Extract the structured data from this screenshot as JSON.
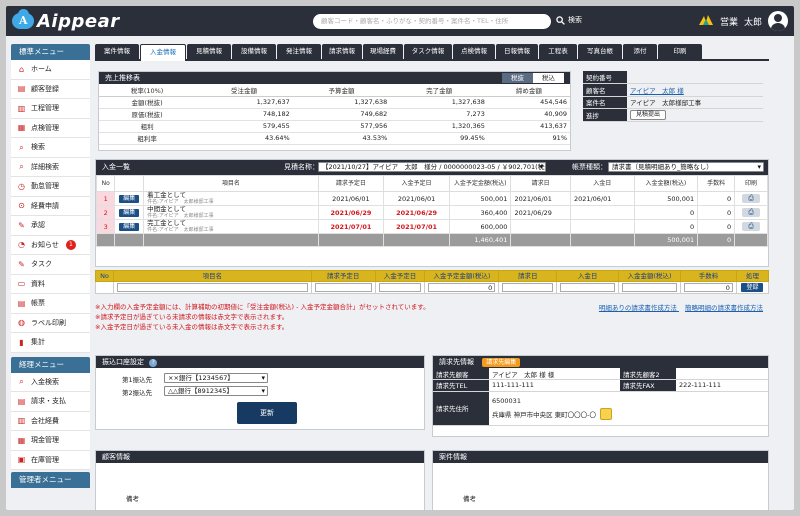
{
  "header": {
    "logo_letter": "A",
    "logo_text": "Aippear",
    "search_placeholder": "顧客コード・顧客名・ふりがな・契約番号・案件名・TEL・住所",
    "search_label": "検索",
    "user_dept": "営業",
    "user_name": "太郎"
  },
  "sidebar": {
    "standard_title": "標準メニュー",
    "standard_items": [
      {
        "label": "ホーム",
        "icon": "home-icon",
        "glyph": "⌂"
      },
      {
        "label": "顧客登録",
        "icon": "customer-icon",
        "glyph": "▤"
      },
      {
        "label": "工程管理",
        "icon": "process-icon",
        "glyph": "▥"
      },
      {
        "label": "点検管理",
        "icon": "inspection-icon",
        "glyph": "▦"
      },
      {
        "label": "検索",
        "icon": "search-icon",
        "glyph": "⌕"
      },
      {
        "label": "詳細検索",
        "icon": "detail-search-icon",
        "glyph": "⌕"
      },
      {
        "label": "勤怠管理",
        "icon": "attendance-icon",
        "glyph": "◷"
      },
      {
        "label": "経費申請",
        "icon": "expense-icon",
        "glyph": "⊙"
      },
      {
        "label": "承認",
        "icon": "approval-icon",
        "glyph": "✎"
      },
      {
        "label": "お知らせ",
        "icon": "notice-icon",
        "glyph": "◔",
        "badge": "1"
      },
      {
        "label": "タスク",
        "icon": "task-icon",
        "glyph": "✎"
      },
      {
        "label": "資料",
        "icon": "document-icon",
        "glyph": "▭"
      },
      {
        "label": "帳票",
        "icon": "form-icon",
        "glyph": "▤"
      },
      {
        "label": "ラベル印刷",
        "icon": "label-print-icon",
        "glyph": "◍"
      },
      {
        "label": "集計",
        "icon": "aggregate-icon",
        "glyph": "▮"
      }
    ],
    "accounting_title": "経理メニュー",
    "accounting_items": [
      {
        "label": "入金検索",
        "icon": "payment-search-icon",
        "glyph": "⌕"
      },
      {
        "label": "請求・支払",
        "icon": "billing-icon",
        "glyph": "▤"
      },
      {
        "label": "会社経費",
        "icon": "company-expense-icon",
        "glyph": "▥"
      },
      {
        "label": "現金管理",
        "icon": "cash-icon",
        "glyph": "▦"
      },
      {
        "label": "在庫管理",
        "icon": "inventory-icon",
        "glyph": "▣"
      }
    ],
    "admin_title": "管理者メニュー"
  },
  "tabs": [
    "案件情報",
    "入金情報",
    "見積情報",
    "設備情報",
    "発注情報",
    "請求情報",
    "現場経費",
    "タスク情報",
    "点検情報",
    "日報情報",
    "工程表",
    "写真台帳",
    "添付",
    "印刷"
  ],
  "active_tab": 1,
  "sales": {
    "title": "売上推移表",
    "toggle": [
      "税抜",
      "税込"
    ],
    "headers": [
      "税率(10%)",
      "受注金額",
      "予算金額",
      "完了金額",
      "締め金額"
    ],
    "rows": [
      [
        "金額(税抜)",
        "1,327,637",
        "1,327,638",
        "1,327,638",
        "454,546"
      ],
      [
        "原価(税抜)",
        "748,182",
        "749,682",
        "7,273",
        "40,909"
      ],
      [
        "粗利",
        "579,455",
        "577,956",
        "1,320,365",
        "413,637"
      ],
      [
        "粗利率",
        "43.64%",
        "43.53%",
        "99.45%",
        "91%"
      ]
    ]
  },
  "contract": {
    "rows": [
      {
        "k": "契約番号",
        "v": ""
      },
      {
        "k": "顧客名",
        "v": "アイピア　太郎 様"
      },
      {
        "k": "案件名",
        "v": "アイピア　太郎様邸工事"
      },
      {
        "k": "進捗",
        "v": "見積提出"
      }
    ]
  },
  "payments": {
    "title": "入金一覧",
    "estimate_label": "見積名称：",
    "estimate_value": "【2021/10/27】アイピア　太郎　様分 / 0000000023-05 / ￥902,701(税込)",
    "form_label": "帳票種類：",
    "form_value": "請求書（見積明細あり_簡略なし）",
    "headers": [
      "No",
      "",
      "項目名",
      "請求予定日",
      "入金予定日",
      "入金予定金額(税込)",
      "請求日",
      "入金日",
      "入金金額(税込)",
      "手数料",
      "印刷"
    ],
    "edit_label": "編集",
    "print_glyph": "⎙",
    "rows": [
      {
        "no": "1",
        "name": "着工金として",
        "sub": "件名:アイピア　太郎様邸工事",
        "bill_plan": "2021/06/01",
        "pay_plan": "2021/06/01",
        "plan_amt": "500,001",
        "bill_date": "2021/06/01",
        "pay_date": "2021/06/01",
        "pay_amt": "500,001",
        "fee": "0",
        "red": false
      },
      {
        "no": "2",
        "name": "中間金として",
        "sub": "件名:アイピア　太郎様邸工事",
        "bill_plan": "2021/06/29",
        "pay_plan": "2021/06/29",
        "plan_amt": "360,400",
        "bill_date": "2021/06/29",
        "pay_date": "",
        "pay_amt": "0",
        "fee": "0",
        "red": true
      },
      {
        "no": "3",
        "name": "完工金として",
        "sub": "件名:アイピア　太郎様邸工事",
        "bill_plan": "2021/07/01",
        "pay_plan": "2021/07/01",
        "plan_amt": "600,000",
        "bill_date": "",
        "pay_date": "",
        "pay_amt": "0",
        "fee": "0",
        "red": true
      }
    ],
    "total_plan": "1,460,401",
    "total_pay": "500,001",
    "total_fee": "0"
  },
  "new_row": {
    "headers": [
      "No",
      "項目名",
      "請求予定日",
      "入金予定日",
      "入金予定金額(税込)",
      "請求日",
      "入金日",
      "入金金額(税込)",
      "手数料",
      "処理"
    ],
    "plan_amount": "0",
    "fee": "0",
    "register": "登録"
  },
  "notes": [
    "※入力欄の入金予定金額には、計算補助の初期値に「受注金額(税込) - 入金予定金額合計」がセットされています。",
    "※請求予定日が過ぎている未請求の情報は赤文字で表示されます。",
    "※入金予定日が過ぎている未入金の情報は赤文字で表示されます。"
  ],
  "note_links": [
    "明細ありの請求書作成方法",
    "簡略明細の請求書作成方法"
  ],
  "bank": {
    "title": "振込口座設定",
    "label1": "第1振込先",
    "value1": "××銀行【1234567】",
    "label2": "第2振込先",
    "value2": "△△銀行【8912345】",
    "update": "更新"
  },
  "billing": {
    "title": "請求先情報",
    "edit": "請求先編集",
    "customer_label": "請求先顧客",
    "customer_value": "アイピア　太郎 様 様",
    "customer2_label": "請求先顧客2",
    "tel_label": "請求先TEL",
    "tel_value": "111-111-111",
    "fax_label": "請求先FAX",
    "fax_value": "222-111-111",
    "addr_label": "請求先住所",
    "zip": "6500031",
    "addr": "兵庫県 神戸市中央区 東町〇〇〇-〇"
  },
  "customer_info": {
    "title": "顧客情報",
    "note_label": "備考"
  },
  "project_info": {
    "title": "案件情報",
    "note_label": "備考"
  },
  "colors": {
    "navy": "#2b2f3a",
    "accent": "#1c4f86",
    "red": "#d3161c",
    "gold": "#d8b51e",
    "orange": "#f29b1d",
    "logo": "#3ea9e6"
  }
}
